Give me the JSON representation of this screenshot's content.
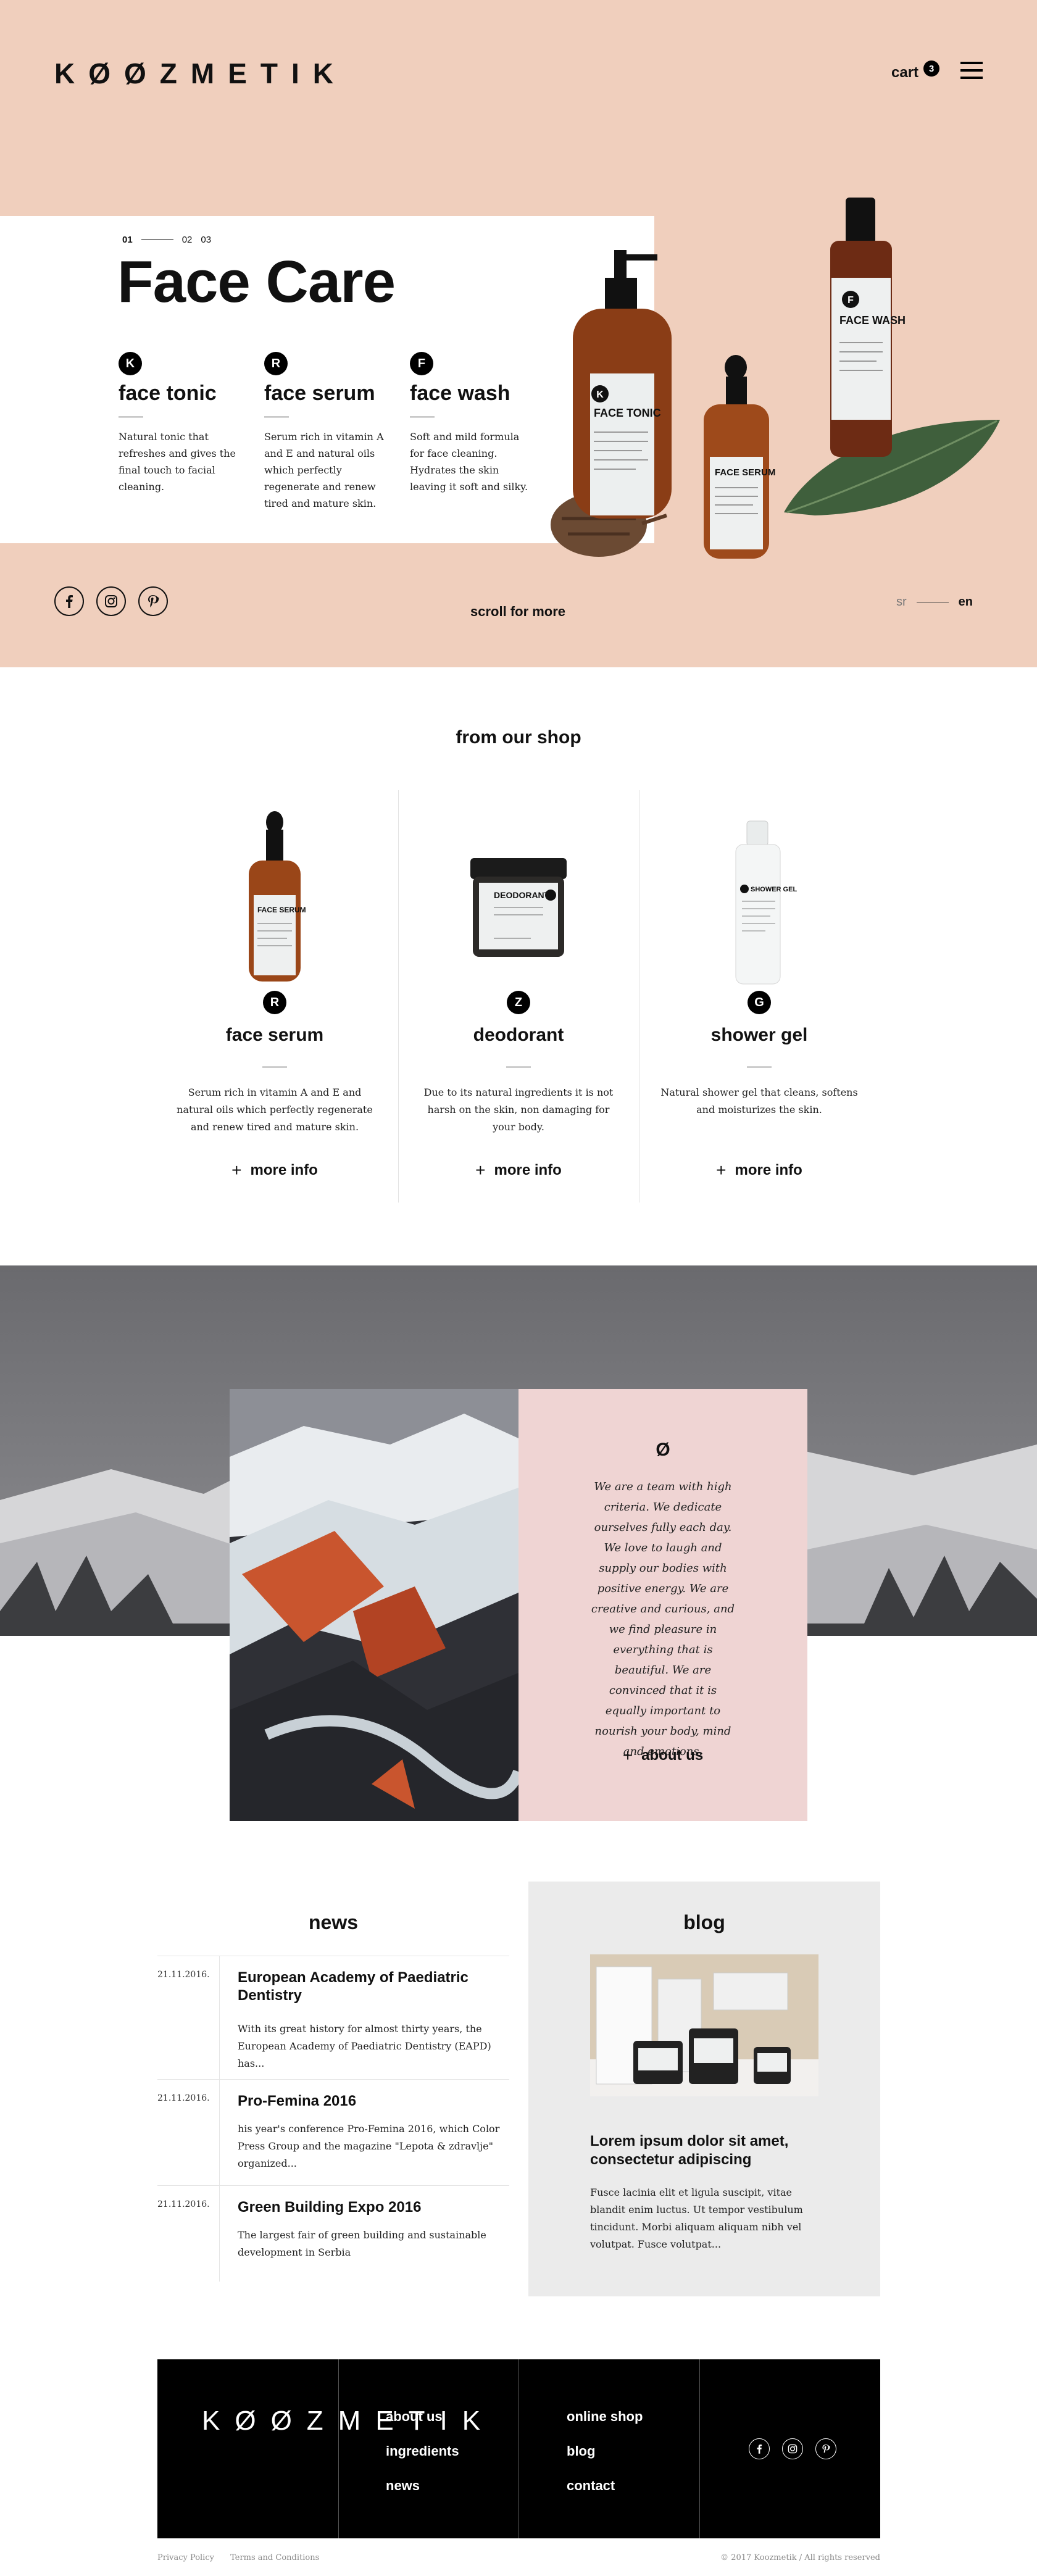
{
  "brand": {
    "logo": "KØØZMETIK",
    "footer_logo": "KØØZMETIK"
  },
  "header": {
    "cart_label": "cart",
    "cart_count": "3"
  },
  "hero": {
    "slides": [
      "01",
      "02",
      "03"
    ],
    "title": "Face Care",
    "features": [
      {
        "badge": "K",
        "title": "face tonic",
        "text": "Natural tonic that refreshes and gives the final touch to facial cleaning."
      },
      {
        "badge": "R",
        "title": "face serum",
        "text": "Serum rich in vitamin A and E and natural oils which perfectly regenerate and renew tired and mature skin."
      },
      {
        "badge": "F",
        "title": "face wash",
        "text": "Soft and mild formula for face cleaning. Hydrates the skin leaving it soft and silky."
      }
    ],
    "scroll_label": "scroll for more",
    "lang": {
      "sr": "sr",
      "en": "en"
    },
    "product_labels": {
      "tonic_badge": "K",
      "tonic": "FACE TONIC",
      "serum": "FACE SERUM",
      "wash_badge": "F",
      "wash": "FACE WASH"
    }
  },
  "shop": {
    "title": "from our shop",
    "products": [
      {
        "badge": "R",
        "title": "face serum",
        "text": "Serum rich in vitamin A and E and natural oils which perfectly regenerate and renew tired and mature skin.",
        "more": "more info",
        "img_label": "FACE SERUM"
      },
      {
        "badge": "Z",
        "title": "deodorant",
        "text": "Due to its natural ingredients it is not harsh on the skin, non damaging for your body.",
        "more": "more info",
        "img_label": "DEODORANT"
      },
      {
        "badge": "G",
        "title": "shower gel",
        "text": "Natural shower gel that cleans, softens and moisturizes the skin.",
        "more": "more info",
        "img_label": "SHOWER GEL"
      }
    ]
  },
  "about": {
    "symbol": "Ø",
    "text": "We are a team with high criteria. We dedicate ourselves fully each day. We love to laugh and supply our bodies with positive energy. We are creative and curious, and we find pleasure in everything that is beautiful. We are convinced that it is equally important to nourish your body, mind and emotions.",
    "link": "about us"
  },
  "news": {
    "title": "news",
    "items": [
      {
        "date": "21.11.2016.",
        "title": "European Academy of Paediatric Dentistry",
        "text": "With its great history for almost thirty years, the European Academy of Paediatric Dentistry (EAPD) has..."
      },
      {
        "date": "21.11.2016.",
        "title": "Pro-Femina 2016",
        "text": "his year's conference Pro-Femina 2016, which Color Press Group and the magazine \"Lepota & zdravlje\" organized..."
      },
      {
        "date": "21.11.2016.",
        "title": "Green Building Expo 2016",
        "text": "The largest fair of green building and sustainable development in Serbia"
      }
    ]
  },
  "blog": {
    "title": "blog",
    "post_title": "Lorem ipsum dolor sit amet, consectetur adipiscing",
    "post_text": "Fusce lacinia elit et ligula suscipit, vitae blandit enim luctus. Ut tempor vestibulum tincidunt. Morbi aliquam aliquam nibh vel volutpat. Fusce volutpat..."
  },
  "footer": {
    "col1": [
      "about us",
      "ingredients",
      "news"
    ],
    "col2": [
      "online shop",
      "blog",
      "contact"
    ],
    "privacy": "Privacy Policy",
    "terms": "Terms and Conditions",
    "copyright": "© 2017 Koozmetik / All rights reserved"
  },
  "colors": {
    "hero_bg": "#f0cfbd",
    "about_panel": "#efd4d3",
    "blog_bg": "#ebebeb",
    "footer_bg": "#000000"
  },
  "icons": [
    "cart-badge",
    "hamburger-menu-icon",
    "facebook-icon",
    "instagram-icon",
    "pinterest-icon",
    "plus-icon"
  ]
}
